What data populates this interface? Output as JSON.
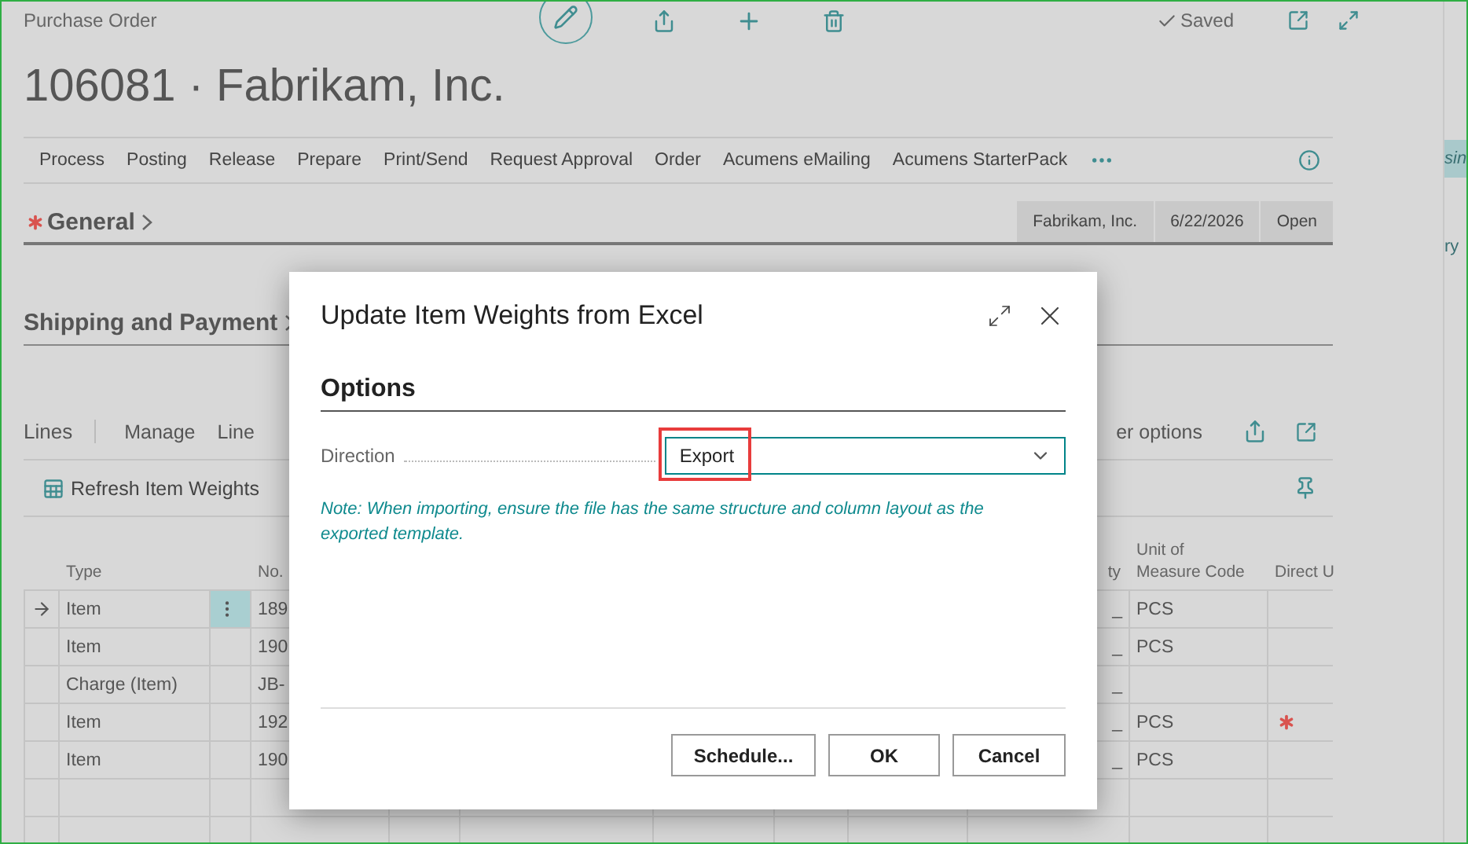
{
  "page": {
    "caption": "Purchase Order",
    "status": "Saved",
    "title": "106081 · Fabrikam, Inc."
  },
  "actions": [
    "Process",
    "Posting",
    "Release",
    "Prepare",
    "Print/Send",
    "Request Approval",
    "Order",
    "Acumens eMailing",
    "Acumens StarterPack"
  ],
  "general": {
    "label": "General",
    "required": true,
    "facts": [
      "Fabrikam, Inc.",
      "6/22/2026",
      "Open"
    ]
  },
  "shipping": {
    "label": "Shipping and Payment"
  },
  "lines": {
    "label": "Lines",
    "tabs": [
      "Manage",
      "Line"
    ],
    "more": "er options",
    "refresh": "Refresh Item Weights"
  },
  "table": {
    "headers": {
      "type": "Type",
      "no": "No.",
      "qty": "ty",
      "unit": "Unit of Measure Code",
      "direct": "Direct U"
    },
    "rows": [
      {
        "selected": true,
        "type": "Item",
        "no": "189",
        "qty": "_",
        "unit": "PCS",
        "missing": false
      },
      {
        "selected": false,
        "type": "Item",
        "no": "190",
        "qty": "_",
        "unit": "PCS",
        "missing": false
      },
      {
        "selected": false,
        "type": "Charge (Item)",
        "no": "JB-",
        "qty": "_",
        "unit": "",
        "missing": false
      },
      {
        "selected": false,
        "type": "Item",
        "no": "192",
        "qty": "_",
        "unit": "PCS",
        "missing": true
      },
      {
        "selected": false,
        "type": "Item",
        "no": "190",
        "qty": "_",
        "unit": "PCS",
        "missing": false
      }
    ]
  },
  "side": [
    "sin",
    "ry"
  ],
  "dialog": {
    "title": "Update Item Weights from Excel",
    "section": "Options",
    "field": {
      "label": "Direction",
      "value": "Export",
      "highlighted": true
    },
    "note": "Note: When importing, ensure the file has the same structure and column layout as the exported template.",
    "buttons": [
      "Schedule...",
      "OK",
      "Cancel"
    ]
  }
}
